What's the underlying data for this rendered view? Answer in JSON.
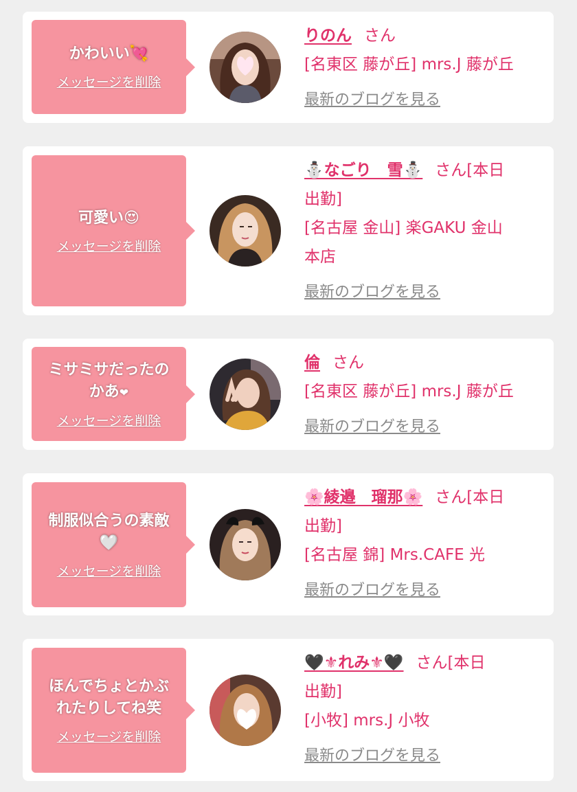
{
  "delete_label": "メッセージを削除",
  "blog_label": "最新のブログを見る",
  "colors": {
    "accent": "#e0316a",
    "bubble": "#f6949f",
    "card": "#ffffff",
    "background": "#efefef"
  },
  "cards": [
    {
      "message": "かわいい",
      "message_emoji": "💘",
      "name": "りのん",
      "suffix": "さん",
      "location_lines": [
        "[名東区 藤が丘] mrs.J 藤が丘"
      ],
      "avatar_desc": "woman-brown-hair"
    },
    {
      "message": "可愛い",
      "message_emoji": "😍",
      "name": "⛄なごり　雪⛄",
      "suffix": "さん[本日",
      "status_line": "出勤]",
      "location_lines": [
        "[名古屋 金山] 楽GAKU 金山",
        "本店"
      ],
      "avatar_desc": "woman-blonde-hair"
    },
    {
      "message": "ミサミサだったの",
      "message_line2": "かあ",
      "message_emoji": "❤",
      "name": "倫",
      "suffix": "さん",
      "location_lines": [
        "[名東区 藤が丘] mrs.J 藤が丘"
      ],
      "avatar_desc": "woman-peace-sign"
    },
    {
      "message": "制服似合うの素敵",
      "message_emoji": "🤍",
      "name": "🌸綾邉　瑠那🌸",
      "suffix": "さん[本日",
      "status_line": "出勤]",
      "location_lines": [
        "[名古屋 錦] Mrs.CAFE 光"
      ],
      "avatar_desc": "woman-with-bow"
    },
    {
      "message": "ほんでちょとかぶ",
      "message_line2": "れたりしてね笑",
      "name": "🖤⚜れみ⚜🖤",
      "suffix": "さん[本日",
      "status_line": "出勤]",
      "location_lines": [
        "[小牧] mrs.J 小牧"
      ],
      "avatar_desc": "woman-face-hidden-heart"
    }
  ]
}
